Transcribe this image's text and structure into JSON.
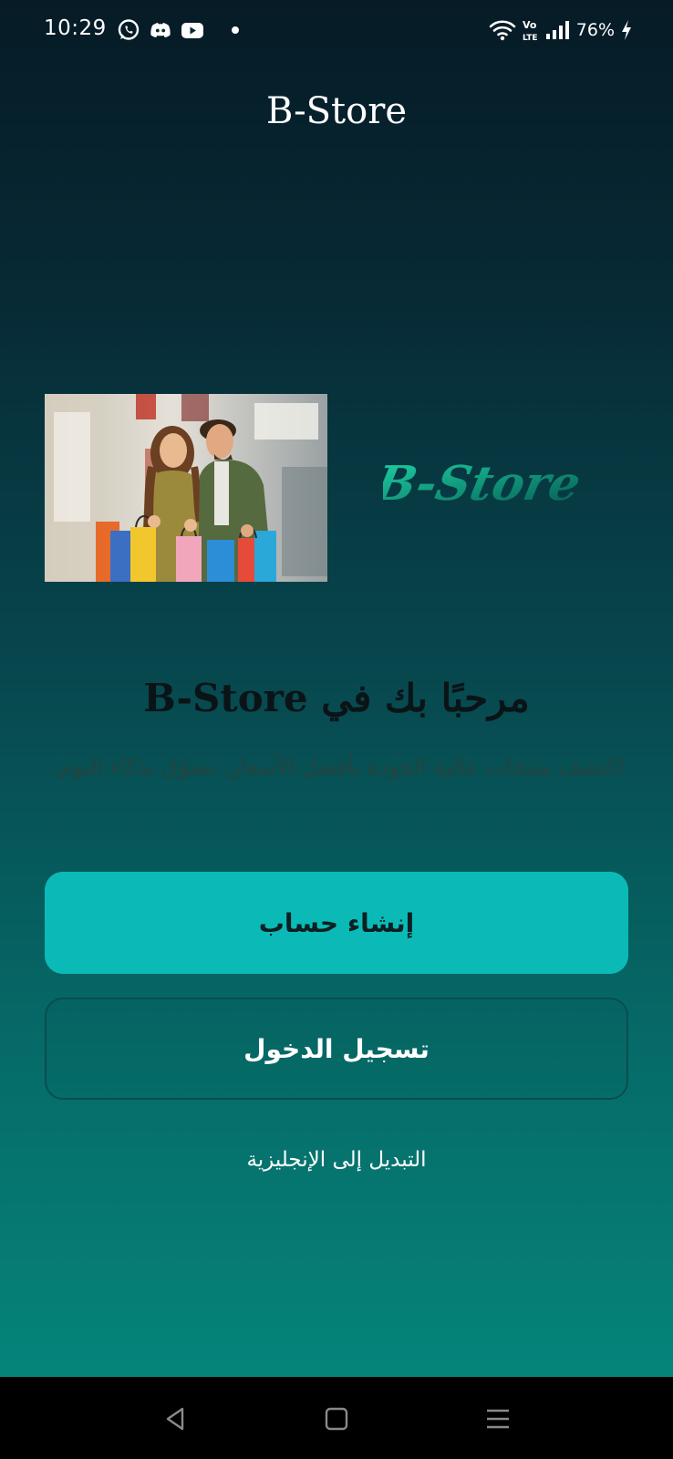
{
  "status_bar": {
    "time": "10:29",
    "battery": "76%",
    "app_icons": [
      "whatsapp-icon",
      "discord-icon",
      "youtube-icon",
      "dot-icon"
    ],
    "system_icons": [
      "wifi-icon",
      "volte-icon",
      "signal-icon",
      "battery-charging-icon"
    ]
  },
  "header": {
    "title": "B-Store"
  },
  "hero": {
    "logo_text": "B-Store"
  },
  "welcome": {
    "title": "مرحبًا بك في B-Store",
    "subtitle": "اكتشف منتجات عالية الجودة بأفضل الأسعار. تسوّق بذكاء اليوم."
  },
  "buttons": {
    "create_account": "إنشاء حساب",
    "login": "تسجيل الدخول"
  },
  "language_toggle": "التبديل إلى الإنجليزية",
  "colors": {
    "accent": "#0bbab6",
    "gradient_top": "#061b26",
    "gradient_bottom": "#058b7f"
  },
  "nav_bar": {
    "items": [
      "back-icon",
      "home-icon",
      "recents-icon"
    ]
  }
}
